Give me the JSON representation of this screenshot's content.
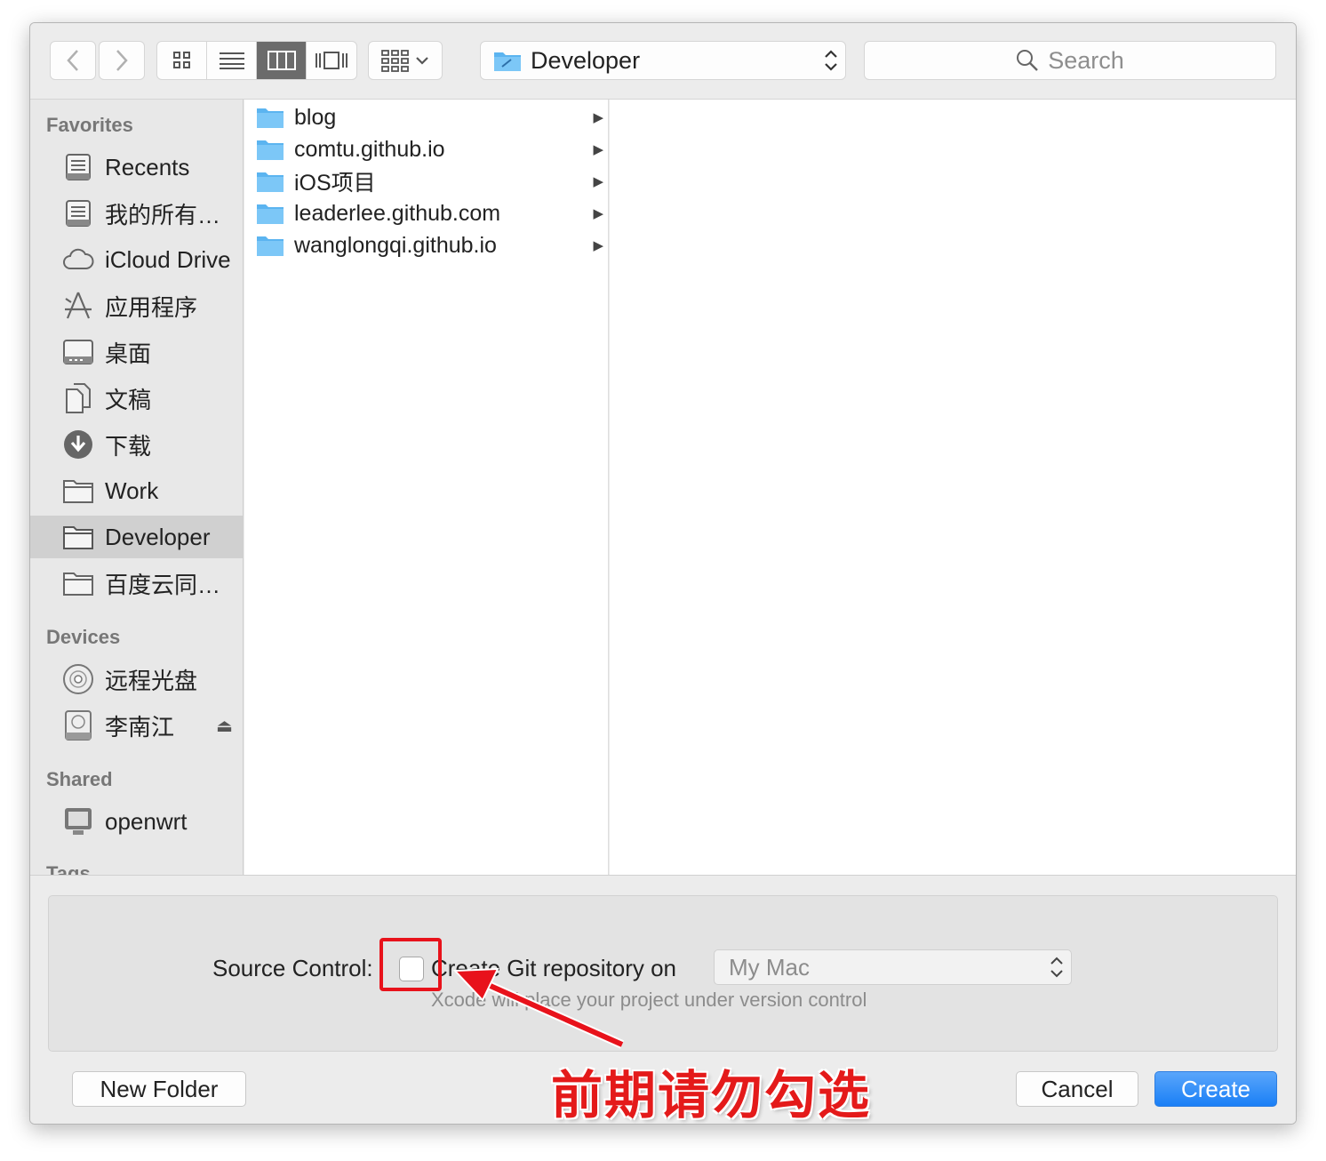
{
  "toolbar": {
    "location": "Developer",
    "search_placeholder": "Search"
  },
  "sidebar": {
    "favorites_title": "Favorites",
    "favorites": [
      {
        "label": "Recents"
      },
      {
        "label": "我的所有…"
      },
      {
        "label": "iCloud Drive"
      },
      {
        "label": "应用程序"
      },
      {
        "label": "桌面"
      },
      {
        "label": "文稿"
      },
      {
        "label": "下载"
      },
      {
        "label": "Work"
      },
      {
        "label": "Developer"
      },
      {
        "label": "百度云同…"
      }
    ],
    "devices_title": "Devices",
    "devices": [
      {
        "label": "远程光盘"
      },
      {
        "label": "李南江"
      }
    ],
    "shared_title": "Shared",
    "shared": [
      {
        "label": "openwrt"
      }
    ],
    "tags_title": "Tags"
  },
  "column1": {
    "items": [
      {
        "label": "blog"
      },
      {
        "label": "comtu.github.io"
      },
      {
        "label": "iOS项目"
      },
      {
        "label": "leaderlee.github.com"
      },
      {
        "label": "wanglongqi.github.io"
      }
    ]
  },
  "source_control": {
    "label": "Source Control:",
    "checkbox_label": "Create Git repository on",
    "location": "My Mac",
    "note": "Xcode will place your project under version control"
  },
  "buttons": {
    "new_folder": "New Folder",
    "cancel": "Cancel",
    "create": "Create"
  },
  "annotation": {
    "text": "前期请勿勾选"
  },
  "colors": {
    "accent": "#1a7ff6",
    "annotation_red": "#e41a1a",
    "folder_blue": "#5bb4f0"
  }
}
